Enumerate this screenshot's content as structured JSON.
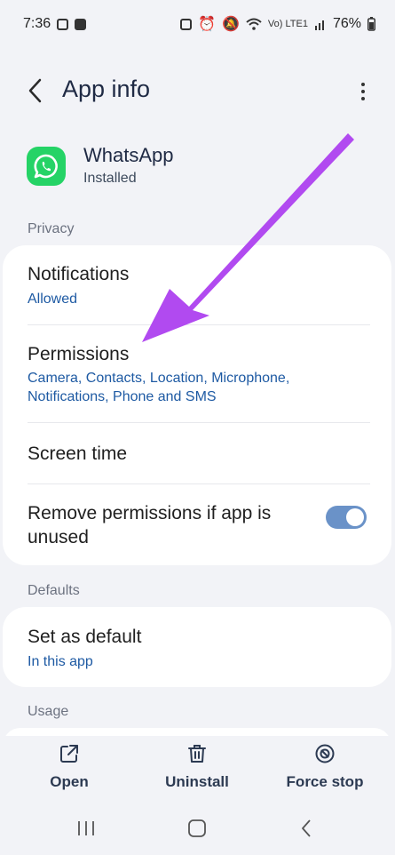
{
  "status_bar": {
    "time": "7:36",
    "network": "Vo) LTE1",
    "battery": "76%"
  },
  "header": {
    "title": "App info"
  },
  "app": {
    "name": "WhatsApp",
    "status": "Installed"
  },
  "sections": {
    "privacy": {
      "label": "Privacy",
      "notifications": {
        "title": "Notifications",
        "sub": "Allowed"
      },
      "permissions": {
        "title": "Permissions",
        "sub_line1": "Camera, Contacts, Location, Microphone,",
        "sub_line2": "Notifications, Phone and SMS"
      },
      "screen_time": {
        "title": "Screen time"
      },
      "remove_permissions": {
        "title_line1": "Remove permissions if app is",
        "title_line2": "unused",
        "enabled": true
      }
    },
    "defaults": {
      "label": "Defaults",
      "set_as_default": {
        "title": "Set as default",
        "sub": "In this app"
      }
    },
    "usage": {
      "label": "Usage"
    }
  },
  "actions": {
    "open": "Open",
    "uninstall": "Uninstall",
    "force_stop": "Force stop"
  },
  "colors": {
    "accent": "#1e5aa3",
    "whatsapp_green": "#25d366",
    "arrow": "#b14af0",
    "toggle_on": "#6a92c8"
  }
}
